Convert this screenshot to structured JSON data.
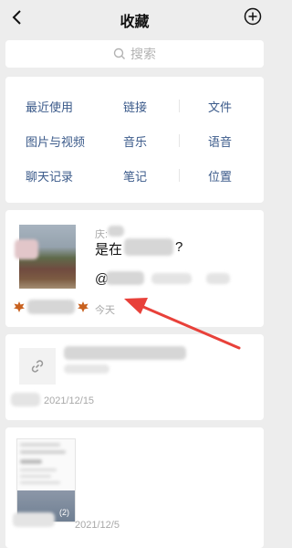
{
  "header": {
    "title": "收藏",
    "back_icon": "chevron-left-icon",
    "add_icon": "circle-plus-icon"
  },
  "search": {
    "placeholder": "搜索"
  },
  "categories": {
    "recent": "最近使用",
    "link": "链接",
    "file": "文件",
    "media": "图片与视频",
    "music": "音乐",
    "voice": "语音",
    "chat": "聊天记录",
    "note": "笔记",
    "location": "位置"
  },
  "items": [
    {
      "sender_prefix": "庆:",
      "title_start": "是在",
      "title_end": "?",
      "mention_prefix": "@",
      "time": "今天"
    },
    {
      "date": "2021/12/15"
    },
    {
      "date": "2021/12/5",
      "thumb_badge": "(2)"
    }
  ],
  "colors": {
    "background": "#ededed",
    "card": "#ffffff",
    "category_text": "#3b5a8a",
    "annotation_arrow": "#e8413a"
  }
}
